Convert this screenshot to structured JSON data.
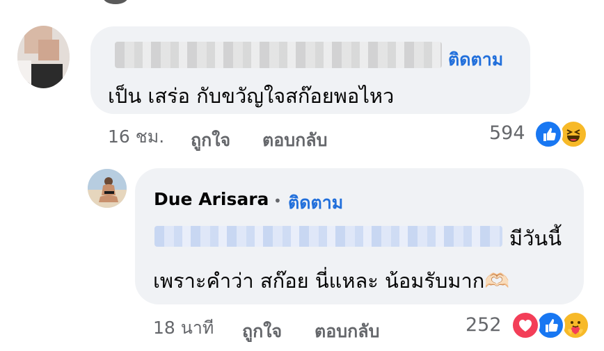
{
  "comment1": {
    "follow_label": "ติดตาม",
    "text": "เป็น เสร่อ กับขวัญใจสก๊อยพอไหว",
    "time": "16 ชม.",
    "like_label": "ถูกใจ",
    "reply_label": "ตอบกลับ",
    "reaction_count": "594",
    "reactions": [
      "like-icon",
      "haha-icon"
    ]
  },
  "reply1": {
    "author": "Due Arisara",
    "separator": "•",
    "follow_label": "ติดตาม",
    "line1_tail": "มีวันนี้",
    "line2": "เพราะคำว่า สก๊อย นี่แหละ น้อมรับมาก🫶🏻",
    "time": "18 นาที",
    "like_label": "ถูกใจ",
    "reply_label": "ตอบกลับ",
    "reaction_count": "252",
    "reactions": [
      "love-icon",
      "like-icon",
      "care-icon"
    ]
  },
  "colors": {
    "link_blue": "#216fdb",
    "bubble_bg": "#f0f2f5",
    "meta_gray": "#65676b",
    "like_blue": "#1877f2",
    "love_red": "#f33e58",
    "emoji_yellow": "#f7b928"
  }
}
